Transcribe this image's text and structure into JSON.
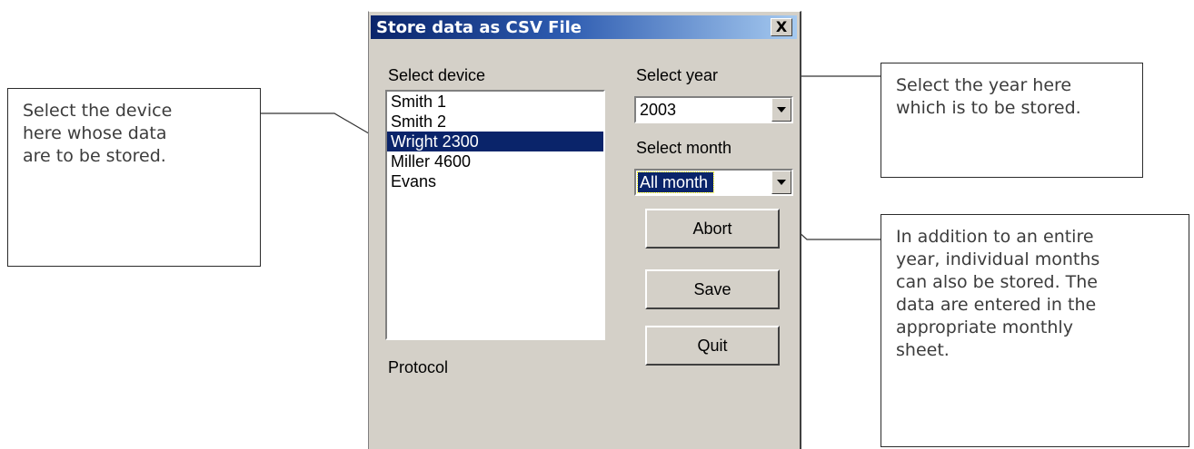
{
  "dialog": {
    "title": "Store data as CSV File",
    "close_label": "X",
    "device_label": "Select device",
    "devices": [
      {
        "label": "Smith 1",
        "selected": false
      },
      {
        "label": "Smith 2",
        "selected": false
      },
      {
        "label": "Wright  2300",
        "selected": true
      },
      {
        "label": "Miller 4600",
        "selected": false
      },
      {
        "label": "Evans",
        "selected": false
      }
    ],
    "year_label": "Select year",
    "year_value": "2003",
    "month_label": "Select month",
    "month_value": "All month",
    "buttons": {
      "abort": "Abort",
      "save": "Save",
      "quit": "Quit"
    },
    "protocol_label": "Protocol",
    "colors": {
      "title_start": "#0a246a",
      "title_end": "#a6caf0",
      "selection": "#0a246a",
      "face": "#d4d0c8"
    }
  },
  "callouts": {
    "device": [
      "Select the device",
      "here whose data",
      "are to be stored."
    ],
    "year": [
      "Select the year here",
      "which is to be stored."
    ],
    "month": [
      "In addition to an entire",
      "year, individual months",
      "can also be stored. The",
      "data are entered in the",
      "appropriate monthly",
      "sheet."
    ]
  }
}
